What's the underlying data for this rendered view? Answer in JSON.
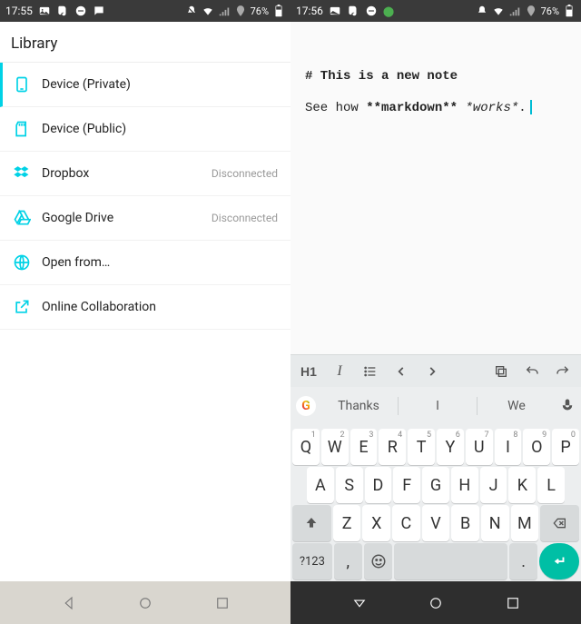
{
  "left": {
    "status": {
      "time": "17:55",
      "battery": "76%"
    },
    "header": "Library",
    "items": [
      {
        "label": "Device (Private)",
        "status": "",
        "selected": true
      },
      {
        "label": "Device (Public)",
        "status": ""
      },
      {
        "label": "Dropbox",
        "status": "Disconnected"
      },
      {
        "label": "Google Drive",
        "status": "Disconnected"
      },
      {
        "label": "Open from…",
        "status": ""
      },
      {
        "label": "Online Collaboration",
        "status": ""
      }
    ]
  },
  "right": {
    "status": {
      "time": "17:56",
      "battery": "76%"
    },
    "note": {
      "h1_raw": "# This is a new note",
      "body_pre": "See how ",
      "body_bold_raw": "**markdown**",
      "body_mid": " ",
      "body_italic_raw": "*works*",
      "body_post": "."
    },
    "toolbar": {
      "h1": "H1",
      "italic": "I"
    },
    "suggestions": {
      "a": "Thanks",
      "b": "I",
      "c": "We"
    },
    "keyboard": {
      "row1": [
        "Q",
        "W",
        "E",
        "R",
        "T",
        "Y",
        "U",
        "I",
        "O",
        "P"
      ],
      "row1_sup": [
        "1",
        "2",
        "3",
        "4",
        "5",
        "6",
        "7",
        "8",
        "9",
        "0"
      ],
      "row2": [
        "A",
        "S",
        "D",
        "F",
        "G",
        "H",
        "J",
        "K",
        "L"
      ],
      "row3": [
        "Z",
        "X",
        "C",
        "V",
        "B",
        "N",
        "M"
      ],
      "sym": "?123",
      "comma": ",",
      "period": "."
    }
  }
}
